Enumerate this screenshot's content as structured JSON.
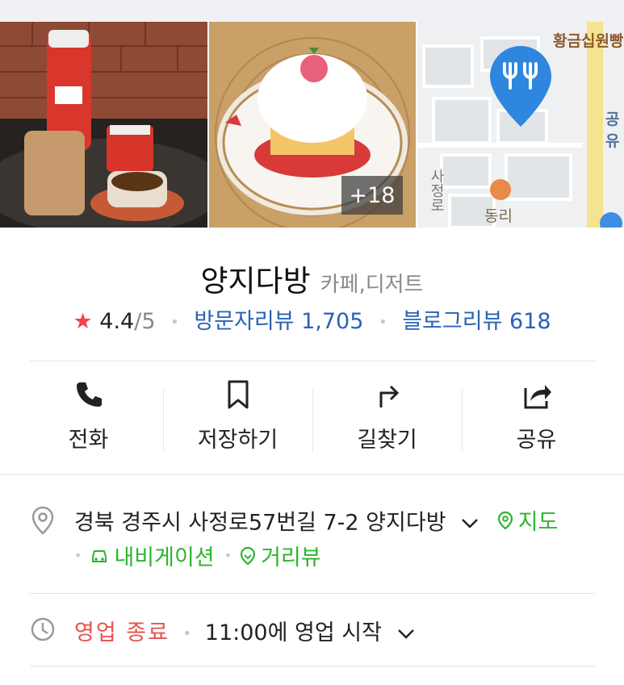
{
  "gallery": {
    "photo_count_badge": "+18",
    "map": {
      "label_top": "황금십원빵",
      "label_right": "공유",
      "label_street": "사정로",
      "label_bottom": "동리"
    }
  },
  "place": {
    "name": "양지다방",
    "category": "카페,디저트",
    "rating": "4.4",
    "rating_max": "/5",
    "visitor_reviews": "방문자리뷰 1,705",
    "blog_reviews": "블로그리뷰 618"
  },
  "actions": [
    {
      "label": "전화",
      "icon": "phone-icon"
    },
    {
      "label": "저장하기",
      "icon": "bookmark-icon"
    },
    {
      "label": "길찾기",
      "icon": "directions-icon"
    },
    {
      "label": "공유",
      "icon": "share-icon"
    }
  ],
  "address": {
    "text": "경북 경주시 사정로57번길 7-2 양지다방",
    "map_link": "지도",
    "navigation_link": "내비게이션",
    "streetview_link": "거리뷰"
  },
  "hours": {
    "status": "영업 종료",
    "next_open": "11:00에 영업 시작"
  },
  "colors": {
    "accent_blue": "#2a62b5",
    "accent_green": "#2db52f",
    "status_red": "#e5534b",
    "star_red": "#f4434a"
  }
}
